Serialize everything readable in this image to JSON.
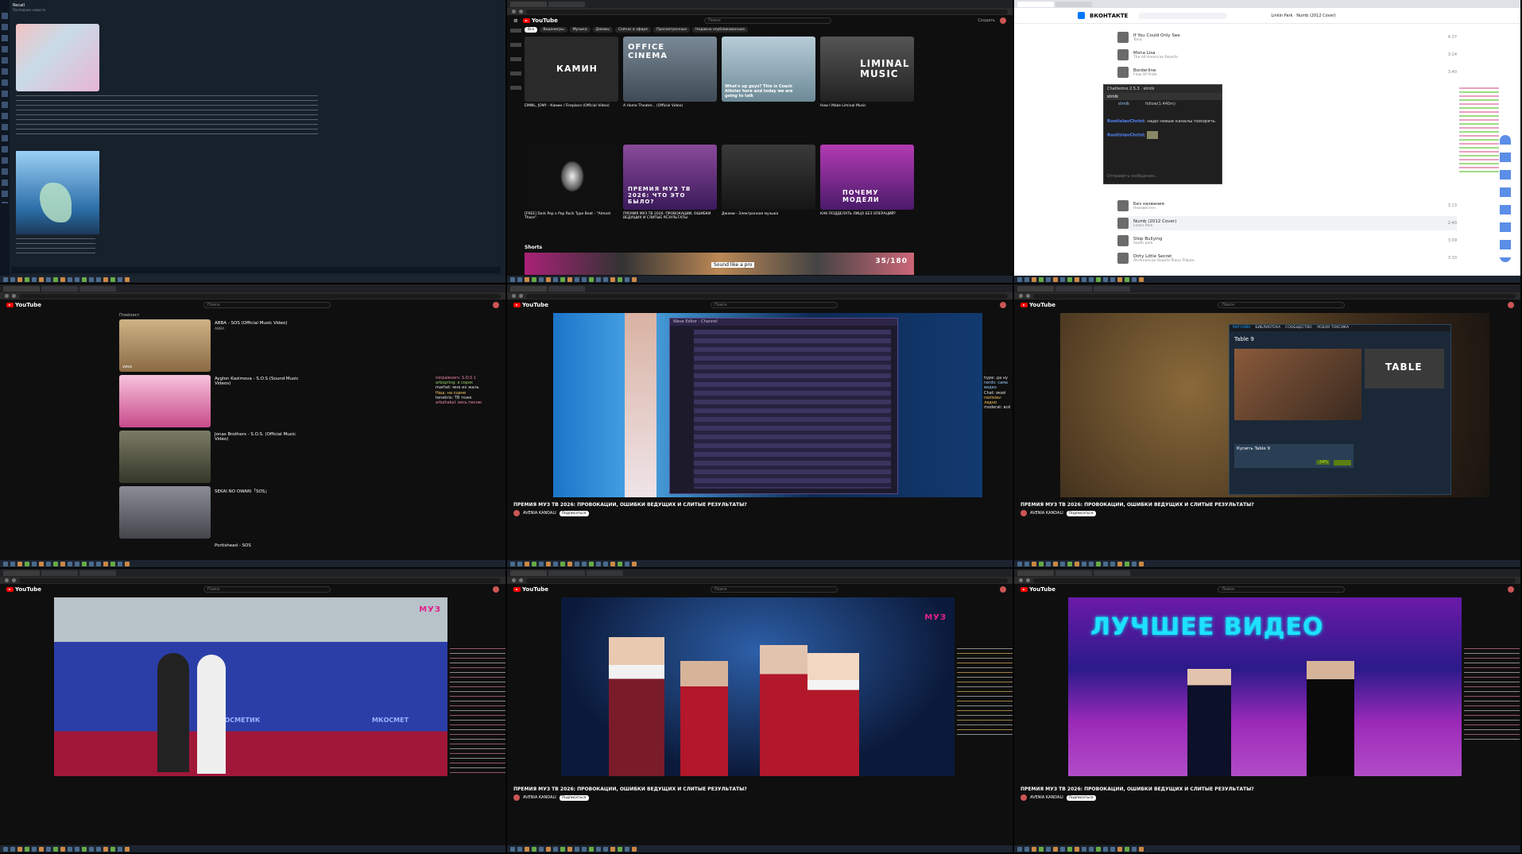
{
  "pane1": {
    "chat_title": "Recall",
    "messages_snippet": "Последние новости"
  },
  "yt_common": {
    "logo_label": "YouTube",
    "search_placeholder": "Поиск",
    "create_label": "Создать",
    "live_title": "ПРЕМИЯ МУЗ ТВ 2026: ПРОВОКАЦИИ, ОШИБКИ ВЕДУЩИХ И СЛИТЫЕ РЕЗУЛЬТАТЫ?",
    "channel_name": "AVENIA KANDALI",
    "subscribe_label": "Подписаться"
  },
  "pane2": {
    "tabs": [
      "Все",
      "Видеоигры",
      "Музыка",
      "Джемы",
      "Сейчас в эфире",
      "Просмотренные",
      "Недавно опубликованные"
    ],
    "cards": [
      {
        "title": "EMINL, JONY - Камин / Fireplace (Official Video)",
        "channel": "EMINL",
        "thumb_text": "КАМИН",
        "color": "#2a2a2a"
      },
      {
        "title": "A Home Theater... (Official Video)",
        "channel": "Just Rider",
        "thumb_text": "OFFICE CINEMA",
        "color": "#5a6a78"
      },
      {
        "title": "What's up guys? This is Coach Allister here and today we are going to talk",
        "channel": "",
        "thumb_text": "",
        "color": "#8fa7b5"
      },
      {
        "title": "How I Make Liminal Music",
        "channel": "",
        "thumb_text": "LIMINAL MUSIC",
        "color": "#3a3a3a"
      }
    ],
    "cards2": [
      {
        "title": "[FREE] Dark Pop x Pop Rock Type Beat - \"Almost There\"",
        "thumb_text": "",
        "color": "#111"
      },
      {
        "title": "ПРЕМИЯ МУЗ ТВ 2026: ПРОВОКАЦИИ, ОШИБКИ ВЕДУЩИХ И СЛИТЫЕ РЕЗУЛЬТАТЫ",
        "thumb_text": "ПРЕМИЯ МУЗ ТВ 2026: ЧТО ЭТО БЫЛО?",
        "color": "#6b3a8a"
      },
      {
        "title": "Джами - Электронная музыка",
        "thumb_text": "",
        "color": "#2c2c2c"
      },
      {
        "title": "КАК ПОДДЕЛАТЬ ЛИЦО БЕЗ ОПЕРАЦИЙ?",
        "thumb_text": "ПОЧЕМУ МОДЕЛИ",
        "color": "#7a2f8a"
      }
    ],
    "shorts_label": "Shorts",
    "shorts_caption": "Sound like a pro",
    "shorts_badge": "35/180"
  },
  "pane3": {
    "brand": "ВКОНТАКТЕ",
    "now_playing": "Linkin Park · Numb (2012 Cover)",
    "tracks": [
      {
        "title": "If You Could Only See",
        "artist": "Tonic",
        "dur": "4:37"
      },
      {
        "title": "Mona Lisa",
        "artist": "The All-American Rejects",
        "dur": "3:14"
      },
      {
        "title": "Borderline",
        "artist": "Flow Of Pride",
        "dur": "3:40"
      },
      {
        "title": "Без названия",
        "artist": "Неизвестен",
        "dur": "3:13"
      },
      {
        "title": "Numb (2012 Cover)",
        "artist": "Linkin Park",
        "dur": "2:40"
      },
      {
        "title": "Stop Bullying",
        "artist": "South park",
        "dur": "3:09"
      },
      {
        "title": "Dirty Little Secret",
        "artist": "All-American Rejects Piano Tribute",
        "dur": "3:33"
      }
    ],
    "chatterino_title": "Chatterino 2.5.3 · strnlk",
    "chatterino_tab": "strnlk",
    "chatterino_follow": "follow(1:440m)",
    "chatterino_msg1_user": "RostislavChrist",
    "chatterino_msg1": "надо новые каналы покорять",
    "chatterino_msg2_user": "RostislavChrist",
    "chatterino_input": "Отправить сообщение..."
  },
  "pane4": {
    "header": "Плейлист",
    "items": [
      {
        "title": "ABBA - SOS (Official Music Video)",
        "sub": "ABBA",
        "color": "#c9a675",
        "badge": "vevo"
      },
      {
        "title": "Ayglon Kazimova - S.O.S (Sound Music Videos)",
        "sub": "",
        "color": "#d46fa5",
        "badge": ""
      },
      {
        "title": "Jonas Brothers - S.O.S. (Official Music Video)",
        "sub": "",
        "color": "#5a5f4f",
        "badge": ""
      },
      {
        "title": "SEKAI NO OWARI「SOS」",
        "sub": "",
        "color": "#6c6f77",
        "badge": ""
      },
      {
        "title": "Portishead - SOS",
        "sub": "",
        "color": "#333",
        "badge": ""
      }
    ],
    "chat": [
      "nerpalevers: S.O.S 1",
      "arbopring: в сорок",
      "marhet: мне их жаль",
      "Наш: на сцене",
      "tenebris: ТВ тоже",
      "arbahakal: весь песню"
    ]
  },
  "pane5": {
    "app_title": "Wave Editor - Channel",
    "chat": [
      "hype: да ну",
      "nerds: сама видео",
      "Chat: окей",
      "rostislav: ладно",
      "moderat: всё"
    ]
  },
  "pane6": {
    "store_title": "Table 9",
    "store_menu": [
      "МАГАЗИН",
      "БИБЛИОТЕКА",
      "СООБЩЕСТВО",
      "ЛОБОК ТОКСИКА"
    ],
    "buy_label": "Купить Table 9",
    "discount": "-34%",
    "banner": "TABLE"
  },
  "pane7": {
    "logo": "МУЗ",
    "sponsors": [
      "МКОСМЕТИК",
      "МКОСМЕТ"
    ]
  },
  "pane8": {
    "logo": "МУЗ"
  },
  "pane9": {
    "headline": "ЛУЧШЕЕ ВИДЕО"
  },
  "colors": {
    "yt_red": "#ff0000",
    "vk_blue": "#0077ff",
    "muz_pink": "#e0218a"
  }
}
